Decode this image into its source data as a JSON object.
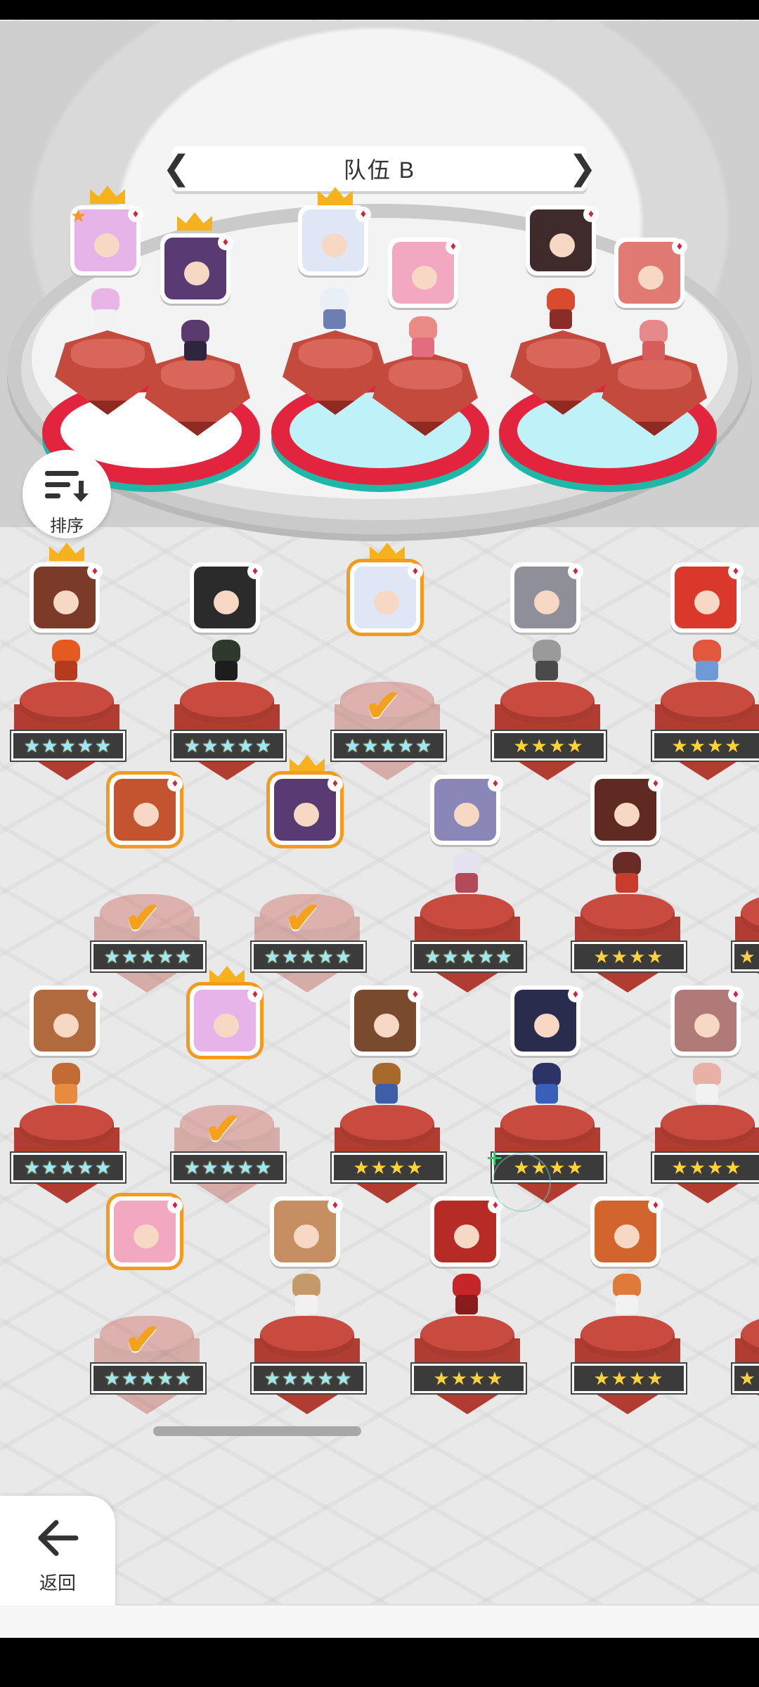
{
  "team": {
    "title": "队伍 B",
    "prev_icon": "chevron-left-icon",
    "next_icon": "chevron-right-icon"
  },
  "sort_button": {
    "label": "排序",
    "icon": "sort-icon"
  },
  "back_button": {
    "label": "返回",
    "icon": "arrow-left-icon"
  },
  "ratings": {
    "five": "★★★★★",
    "four": "★★★★"
  },
  "colors": {
    "accent_orange": "#f39a1f",
    "pad_red": "#e3243f",
    "pad_teal": "#1fb7a8",
    "suit_red": "#d0263c"
  }
}
